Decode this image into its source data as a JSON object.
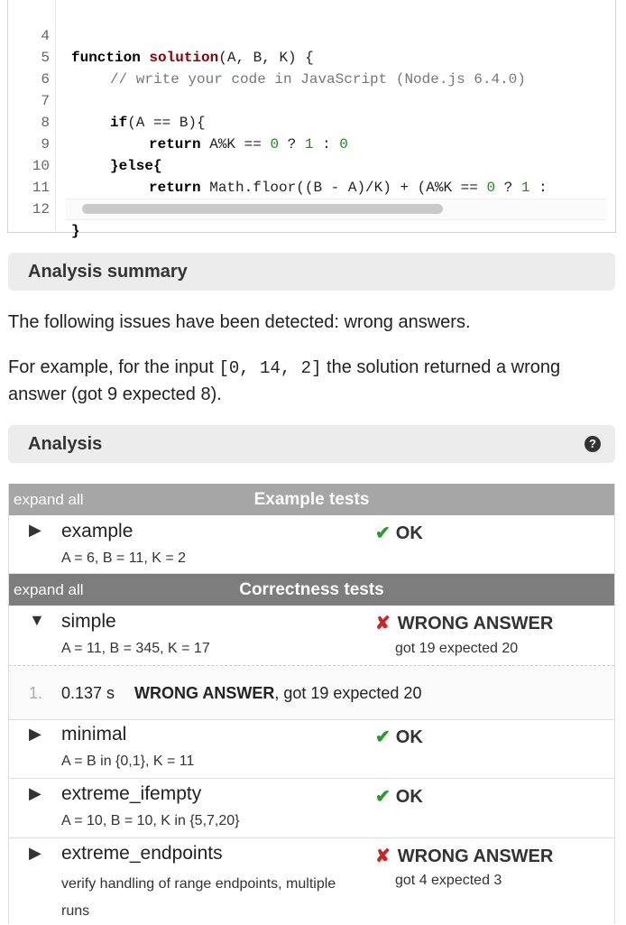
{
  "code": {
    "lines": [
      {
        "n": "4"
      },
      {
        "n": "5"
      },
      {
        "n": "6"
      },
      {
        "n": "7"
      },
      {
        "n": "8"
      },
      {
        "n": "9"
      },
      {
        "n": "10"
      },
      {
        "n": "11"
      },
      {
        "n": "12"
      }
    ],
    "tok": {
      "l4a": "function ",
      "l4b": "solution",
      "l4c": "(A, B, K) {",
      "l5": "// write your code in JavaScript (Node.js 6.4.0)",
      "l7a": "if",
      "l7b": "(A == B){",
      "l8a": "return ",
      "l8b": "A%K == ",
      "l8c": "0",
      "l8d": " ? ",
      "l8e": "1",
      "l8f": " : ",
      "l8g": "0",
      "l9": "}else{",
      "l10a": "return ",
      "l10b": "Math.floor((B - A)/K) + (A%K == ",
      "l10c": "0",
      "l10d": " ? ",
      "l10e": "1",
      "l10f": " :",
      "l11": "}",
      "l12": "}"
    }
  },
  "summary": {
    "title": "Analysis summary",
    "issues": "The following issues have been detected: wrong answers.",
    "example_prefix": "For example, for the input ",
    "example_input": "[0, 14, 2]",
    "example_suffix": " the solution returned a wrong answer (got 9 expected 8)."
  },
  "analysis": {
    "title": "Analysis",
    "help": "?"
  },
  "groups": {
    "example": {
      "expand": "expand all",
      "title": "Example tests",
      "color": "#a6a6a6"
    },
    "correctness": {
      "expand": "expand all",
      "title": "Correctness tests",
      "color": "#7d7d7d"
    }
  },
  "tests": [
    {
      "name": "example",
      "desc": "A = 6, B = 11, K = 2",
      "status": "OK",
      "detail": ""
    },
    {
      "name": "simple",
      "desc": "A = 11, B = 345, K = 17",
      "status": "WRONG ANSWER",
      "detail": "got 19 expected 20"
    },
    {
      "name": "minimal",
      "desc": "A = B in {0,1}, K = 11",
      "status": "OK",
      "detail": ""
    },
    {
      "name": "extreme_ifempty",
      "desc": "A = 10, B = 10, K in {5,7,20}",
      "status": "OK",
      "detail": ""
    },
    {
      "name": "extreme_endpoints",
      "desc": "verify handling of range endpoints, multiple runs",
      "status": "WRONG ANSWER",
      "detail": "got 4 expected 3"
    }
  ],
  "subrun": {
    "index": "1.",
    "time": "0.137 s",
    "verdict": "WRONG ANSWER",
    "detail": ", got 19 expected 20"
  },
  "icons": {
    "ok": "check-icon",
    "bad": "cross-icon",
    "collapsed": "triangle-right-icon",
    "expanded": "triangle-down-icon"
  }
}
